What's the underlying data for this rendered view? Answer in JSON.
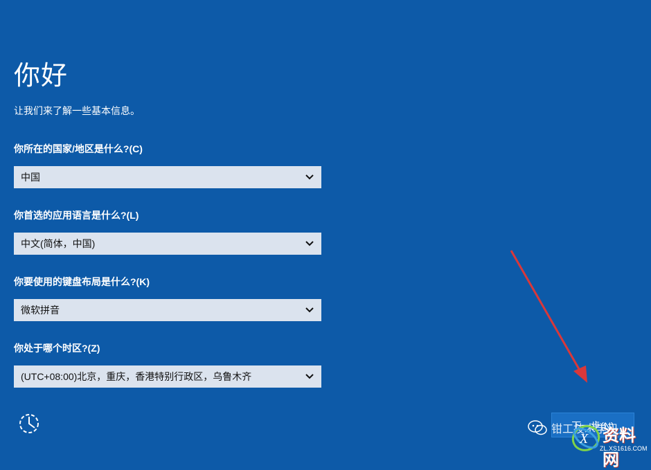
{
  "page": {
    "title": "你好",
    "subtitle": "让我们来了解一些基本信息。"
  },
  "fields": [
    {
      "label": "你所在的国家/地区是什么?(C)",
      "value": "中国"
    },
    {
      "label": "你首选的应用语言是什么?(L)",
      "value": "中文(简体，中国)"
    },
    {
      "label": "你要使用的键盘布局是什么?(K)",
      "value": "微软拼音"
    },
    {
      "label": "你处于哪个时区?(Z)",
      "value": "(UTC+08:00)北京，重庆，香港特别行政区，乌鲁木齐"
    }
  ],
  "footer": {
    "next_label": "下一步(N)",
    "accessibility_icon": "ease-of-access-icon"
  },
  "watermark": {
    "text": "钳工技术学习",
    "logo_text": "资料网",
    "logo_url": "ZL.XS1616.COM"
  },
  "colors": {
    "background": "#0d5aa8",
    "select_bg": "#dbe3ee",
    "arrow": "#d9383a"
  }
}
